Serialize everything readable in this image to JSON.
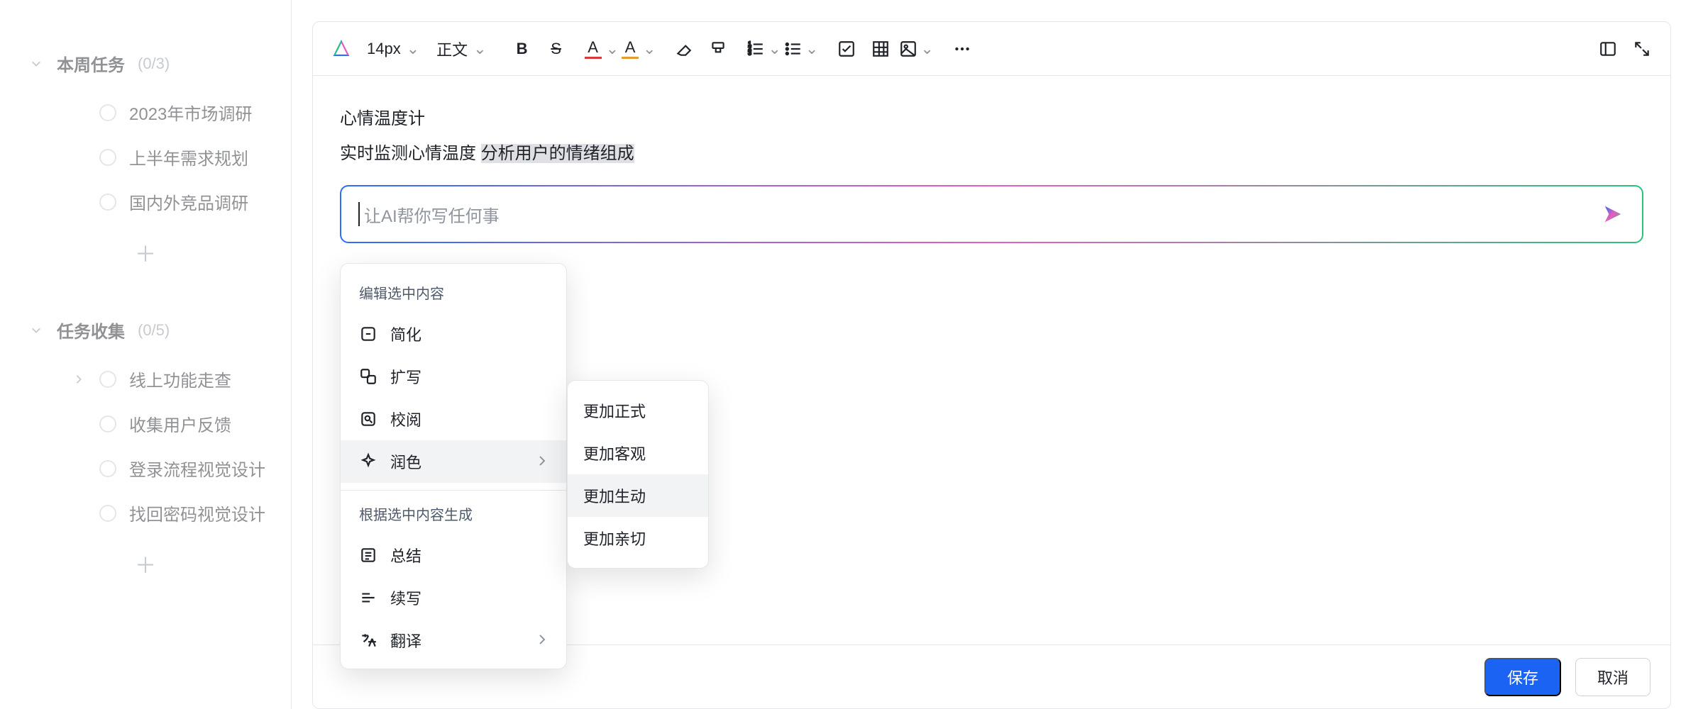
{
  "sidebar": {
    "groups": [
      {
        "title": "本周任务",
        "count": "(0/3)",
        "items": [
          {
            "label": "2023年市场调研"
          },
          {
            "label": "上半年需求规划"
          },
          {
            "label": "国内外竞品调研"
          }
        ]
      },
      {
        "title": "任务收集",
        "count": "(0/5)",
        "items": [
          {
            "label": "线上功能走查",
            "hasChildren": true
          },
          {
            "label": "收集用户反馈"
          },
          {
            "label": "登录流程视觉设计"
          },
          {
            "label": "找回密码视觉设计"
          }
        ]
      }
    ]
  },
  "toolbar": {
    "fontSize": "14px",
    "paragraph": "正文"
  },
  "document": {
    "line1": "心情温度计",
    "line2_prefix": "实时监测心情温度 ",
    "line2_highlight": "分析用户的情绪组成"
  },
  "ai": {
    "placeholder": "让AI帮你写任何事",
    "menu": {
      "editTitle": "编辑选中内容",
      "items": [
        {
          "label": "简化"
        },
        {
          "label": "扩写"
        },
        {
          "label": "校阅"
        },
        {
          "label": "润色",
          "hasSub": true
        }
      ],
      "genTitle": "根据选中内容生成",
      "genItems": [
        {
          "label": "总结"
        },
        {
          "label": "续写"
        },
        {
          "label": "翻译",
          "hasSub": true
        }
      ]
    },
    "subMenu": [
      {
        "label": "更加正式"
      },
      {
        "label": "更加客观"
      },
      {
        "label": "更加生动",
        "hover": true
      },
      {
        "label": "更加亲切"
      }
    ]
  },
  "footer": {
    "save": "保存",
    "cancel": "取消"
  }
}
